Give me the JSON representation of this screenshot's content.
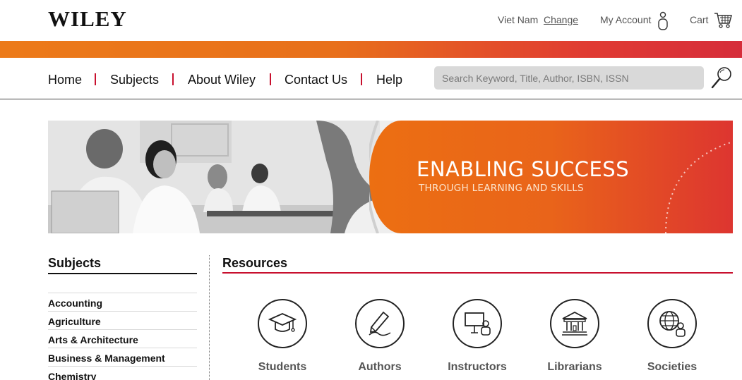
{
  "header": {
    "logo": "WILEY",
    "country": "Viet Nam",
    "change_label": "Change",
    "account_label": "My Account",
    "cart_label": "Cart"
  },
  "nav": {
    "items": [
      {
        "label": "Home"
      },
      {
        "label": "Subjects"
      },
      {
        "label": "About Wiley"
      },
      {
        "label": "Contact Us"
      },
      {
        "label": "Help"
      }
    ],
    "search_placeholder": "Search Keyword, Title, Author, ISBN, ISSN"
  },
  "banner": {
    "title": "ENABLING SUCCESS",
    "subtitle": "THROUGH LEARNING AND SKILLS"
  },
  "subjects": {
    "heading": "Subjects",
    "items": [
      "Accounting",
      "Agriculture",
      "Arts & Architecture",
      "Business & Management",
      "Chemistry"
    ]
  },
  "resources": {
    "heading": "Resources",
    "items": [
      {
        "label": "Students",
        "icon": "graduation-cap-icon"
      },
      {
        "label": "Authors",
        "icon": "pen-writing-icon"
      },
      {
        "label": "Instructors",
        "icon": "presentation-board-icon"
      },
      {
        "label": "Librarians",
        "icon": "library-building-icon"
      },
      {
        "label": "Societies",
        "icon": "globe-person-icon"
      }
    ]
  },
  "colors": {
    "brand_red": "#c8102e",
    "orange": "#ec7a19",
    "search_bg": "#d9d9d9"
  }
}
